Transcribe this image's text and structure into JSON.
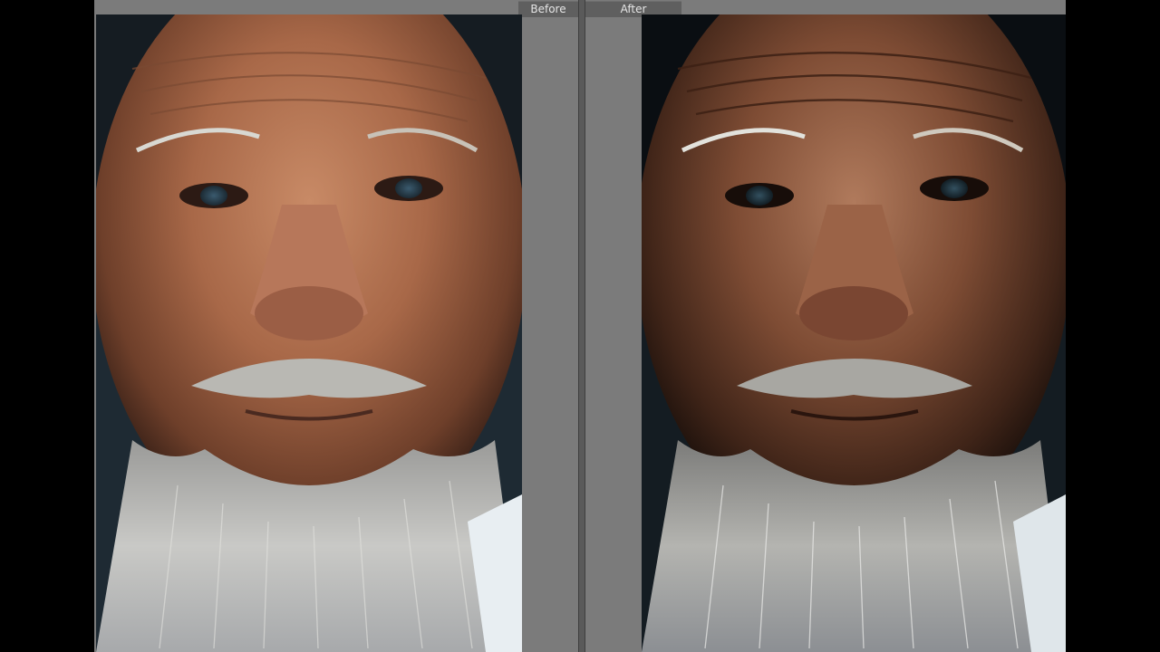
{
  "compare_view": {
    "before_label": "Before",
    "after_label": "After"
  },
  "images": {
    "before": {
      "subject": "elderly-man-portrait",
      "tone": "natural"
    },
    "after": {
      "subject": "elderly-man-portrait",
      "tone": "high-contrast-gritty"
    }
  },
  "colors": {
    "app_background": "#000000",
    "panel_background": "#7b7b7b",
    "label_tab": "#5f5f5f",
    "label_text": "#e6e6e6",
    "divider": "#5a5a5a"
  }
}
